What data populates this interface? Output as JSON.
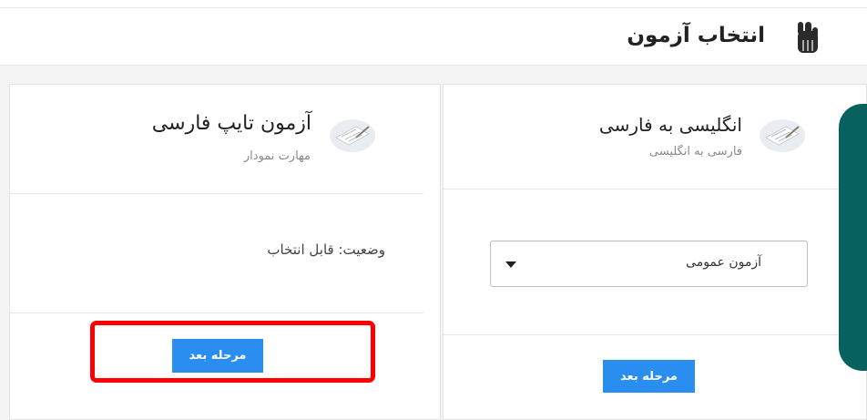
{
  "header": {
    "title": "انتخاب آزمون",
    "icon": "hand-pointer-icon"
  },
  "cards": {
    "right": {
      "title": "انگلیسی به فارسی",
      "subtitle": "فارسی به انگلیسی",
      "avatar_icon": "exam-paper-icon",
      "select": {
        "selected_value": "آزمون عمومی"
      },
      "button_label": "مرحله بعد"
    },
    "left": {
      "title": "آزمون تایپ فارسی",
      "subtitle": "مهارت نمودار",
      "avatar_icon": "exam-paper-icon",
      "status": "وضعیت: قابل انتخاب",
      "button_label": "مرحله بعد"
    }
  },
  "colors": {
    "accent_button": "#2a8ef0",
    "highlight": "#ff0000",
    "side_panel": "#07625f"
  }
}
